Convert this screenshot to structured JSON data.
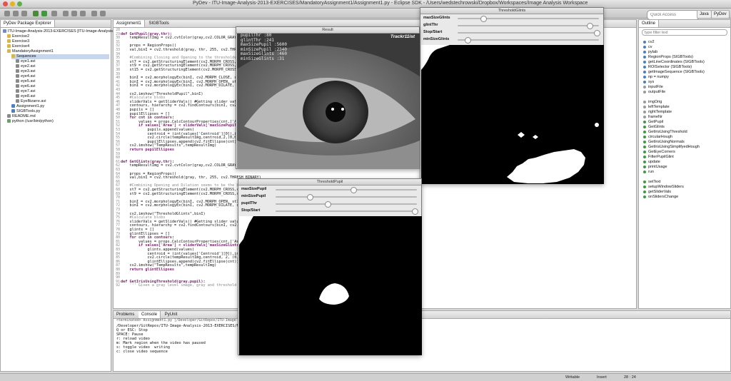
{
  "window": {
    "title": "PyDev - ITU-Image-Analysis-2013-EXERCISES/MandatoryAssignment1/Assignment1.py - Eclipse SDK - /Users/wedstechrowski/Dropbox/Workspaces/Image Analysis Workspace"
  },
  "toolbar": {
    "quick_access_placeholder": "Quick Access",
    "perspectives": [
      "Java",
      "PyDev"
    ]
  },
  "explorer": {
    "tab_label": "PyDev Package Explorer",
    "items": [
      {
        "label": "ITU-Image-Analysis-2013-EXERCISES [ITU-Image-Analysis-2013]",
        "depth": 0,
        "type": "project"
      },
      {
        "label": "Exercise2",
        "depth": 1,
        "type": "folder"
      },
      {
        "label": "Exercise3",
        "depth": 1,
        "type": "folder"
      },
      {
        "label": "Exercise4",
        "depth": 1,
        "type": "folder"
      },
      {
        "label": "MandatoryAssignment1",
        "depth": 1,
        "type": "folder"
      },
      {
        "label": "Sequences",
        "depth": 2,
        "type": "folder",
        "selected": true
      },
      {
        "label": "eye1.avi",
        "depth": 3,
        "type": "file"
      },
      {
        "label": "eye2.avi",
        "depth": 3,
        "type": "file"
      },
      {
        "label": "eye3.avi",
        "depth": 3,
        "type": "file"
      },
      {
        "label": "eye4.avi",
        "depth": 3,
        "type": "file"
      },
      {
        "label": "eye5.avi",
        "depth": 3,
        "type": "file"
      },
      {
        "label": "eye6.avi",
        "depth": 3,
        "type": "file"
      },
      {
        "label": "eye7.avi",
        "depth": 3,
        "type": "file"
      },
      {
        "label": "eye8.avi",
        "depth": 3,
        "type": "file"
      },
      {
        "label": "EyeBizarre.avi",
        "depth": 3,
        "type": "file"
      },
      {
        "label": "Assignment1.py",
        "depth": 2,
        "type": "py"
      },
      {
        "label": "SIGBTools.py",
        "depth": 2,
        "type": "py"
      },
      {
        "label": "README.md",
        "depth": 1,
        "type": "file"
      },
      {
        "label": "python (/usr/bin/python)",
        "depth": 1,
        "type": "lib"
      }
    ]
  },
  "editor": {
    "tabs": [
      "Assignment1",
      "SIGBTools"
    ],
    "lines": [
      {
        "n": "28",
        "t": ""
      },
      {
        "n": "29",
        "t": "def GetPupil(gray,thr):",
        "k": true
      },
      {
        "n": "30",
        "t": "    tempResultImg = cv2.cvtColor(gray,cv2.COLOR_GRAY2BGR)"
      },
      {
        "n": "31",
        "t": ""
      },
      {
        "n": "32",
        "t": "    props = RegionProps()"
      },
      {
        "n": "33",
        "t": "    val,binI = cv2.threshold(gray, thr, 255, cv2.THRESH_BINARY_INV)"
      },
      {
        "n": "34",
        "t": ""
      },
      {
        "n": "35",
        "t": "    #Combining Closing and Opening to the thresholded image",
        "c": true
      },
      {
        "n": "36",
        "t": "    st7 = cv2.getStructuringElement(cv2.MORPH_CROSS,(7,7))"
      },
      {
        "n": "37",
        "t": "    st9 = cv2.getStructuringElement(cv2.MORPH_CROSS,(9,9))"
      },
      {
        "n": "38",
        "t": "    st15 = cv2.getStructuringElement(cv2.MORPH_CROSS,(15,15))"
      },
      {
        "n": "39",
        "t": ""
      },
      {
        "n": "40",
        "t": "    binI = cv2.morphologyEx(binI, cv2.MORPH_CLOSE, st9)"
      },
      {
        "n": "41",
        "t": "    binI = cv2.morphologyEx(binI, cv2.MORPH_OPEN, st15)"
      },
      {
        "n": "42",
        "t": "    binI = cv2.morphologyEx(binI, cv2.MORPH_DILATE, st7)"
      },
      {
        "n": "43",
        "t": ""
      },
      {
        "n": "44",
        "t": "    cv2.imshow(\"ThresholdPupil\",binI)"
      },
      {
        "n": "45",
        "t": "    #Calculate blobs",
        "c": true
      },
      {
        "n": "46",
        "t": "    sliderVals = getSliderVals() #Getting slider values",
        "c2": true
      },
      {
        "n": "47",
        "t": "    contours, hierarchy = cv2.findContours(binI, cv2.RETR_LIST, cv2.CHAIN_APPROX_SIMPLE)"
      },
      {
        "n": "48",
        "t": "    pupils = []"
      },
      {
        "n": "49",
        "t": "    pupilEllipses = []"
      },
      {
        "n": "50",
        "t": "    for cnt in contours:",
        "k": true
      },
      {
        "n": "51",
        "t": "        values = props.CalcContourProperties(cnt,['Area','Length','Centroid'])"
      },
      {
        "n": "52",
        "t": "        if values['Area'] < sliderVals['maxSizePupil']:",
        "k": true
      },
      {
        "n": "53",
        "t": "            pupils.append(values)"
      },
      {
        "n": "54",
        "t": "            centroid = (int(values['Centroid'][0]),int(values['Centroid'][1]))"
      },
      {
        "n": "55",
        "t": "            cv2.circle(tempResultImg,centroid,2,(0,0,255),4)"
      },
      {
        "n": "56",
        "t": "            pupilEllipses.append(cv2.fitEllipse(cnt))"
      },
      {
        "n": "57",
        "t": "    cv2.imshow(\"TempResults\",tempResultImg)"
      },
      {
        "n": "58",
        "t": "    return pupilEllipses",
        "k": true
      },
      {
        "n": "59",
        "t": ""
      },
      {
        "n": "60",
        "t": ""
      },
      {
        "n": "61",
        "t": "def GetGlints(gray,thr):",
        "k": true
      },
      {
        "n": "62",
        "t": "    tempResultImg = cv2.cvtColor(gray,cv2.COLOR_GRAY2BGR)"
      },
      {
        "n": "63",
        "t": ""
      },
      {
        "n": "64",
        "t": "    props = RegionProps()"
      },
      {
        "n": "65",
        "t": "    val,binI = cv2.threshold(gray, thr, 255, cv2.THRESH_BINARY)"
      },
      {
        "n": "66",
        "t": ""
      },
      {
        "n": "67",
        "t": "    #Combining Opening and Dilation seems to be the best",
        "c": true
      },
      {
        "n": "68",
        "t": "    st7 = cv2.getStructuringElement(cv2.MORPH_CROSS,(7,7))"
      },
      {
        "n": "69",
        "t": "    st9 = cv2.getStructuringElement(cv2.MORPH_CROSS,(9,9))"
      },
      {
        "n": "70",
        "t": ""
      },
      {
        "n": "71",
        "t": "    binI = cv2.morphologyEx(binI, cv2.MORPH_OPEN, st7)"
      },
      {
        "n": "72",
        "t": "    binI = cv2.morphologyEx(binI, cv2.MORPH_DILATE, st9)"
      },
      {
        "n": "73",
        "t": ""
      },
      {
        "n": "74",
        "t": "    cv2.imshow(\"ThresholdGlints\",binI)"
      },
      {
        "n": "75",
        "t": "    #Calculate blobs",
        "c": true
      },
      {
        "n": "76",
        "t": "    sliderVals = getSliderVals() #Getting slider values",
        "c2": true
      },
      {
        "n": "77",
        "t": "    contours, hierarchy = cv2.findContours(binI, cv2.RETR_LIST, cv2.CHAIN_APPROX_SIMPLE)"
      },
      {
        "n": "78",
        "t": "    glints = []"
      },
      {
        "n": "79",
        "t": "    glintEllipses = []"
      },
      {
        "n": "80",
        "t": "    for cnt in contours:",
        "k": true
      },
      {
        "n": "81",
        "t": "        values = props.CalcContourProperties(cnt,['Area','Length','Centroid'])"
      },
      {
        "n": "82",
        "t": "        if values['Area'] < sliderVals['maxSizeGlints']:",
        "k": true
      },
      {
        "n": "83",
        "t": "            glints.append(values)"
      },
      {
        "n": "84",
        "t": "            centroid = (int(values['Centroid'][0]),int(values['Centroid'][1]))"
      },
      {
        "n": "85",
        "t": "            cv2.circle(tempResultImg,centroid, 2, (0,0,255),4)"
      },
      {
        "n": "86",
        "t": "            glintEllipses.append(cv2.fitEllipse(cnt))"
      },
      {
        "n": "87",
        "t": "    cv2.imshow(\"TempResults\",tempResultImg)"
      },
      {
        "n": "88",
        "t": "    return glintEllipses",
        "k": true
      },
      {
        "n": "89",
        "t": ""
      },
      {
        "n": "90",
        "t": ""
      },
      {
        "n": "91",
        "t": "def GetIrisUsingThreshold(gray,pupil):",
        "k": true
      },
      {
        "n": "92",
        "t": "    ''' Given a gray level image, gray and threshold",
        "c": true
      }
    ]
  },
  "result_window": {
    "title": "Result",
    "overlay_lines": [
      "pupilThr :80",
      "glintThr :241",
      "maxSizePupil :5600",
      "minSizePupil :2340",
      "maxSizeGlints :460",
      "minSizeGlints :31"
    ],
    "brand": "Trackr11ist"
  },
  "threshold_glints": {
    "title": "ThresholdGlints",
    "sliders": [
      {
        "label": "maxSizeGlints",
        "value": 0.17
      },
      {
        "label": "glintThr",
        "value": 0.95
      },
      {
        "label": "Stop/Start",
        "value": 1.0
      },
      {
        "label": "minSizeGlints",
        "value": 0.05
      }
    ]
  },
  "threshold_pupil": {
    "title": "ThresholdPupil",
    "sliders": [
      {
        "label": "maxSizePupil",
        "value": 0.55
      },
      {
        "label": "minSizePupil",
        "value": 0.23
      },
      {
        "label": "pupilThr",
        "value": 0.36
      },
      {
        "label": "Stop/Start",
        "value": 1.0
      }
    ]
  },
  "outline": {
    "tab_label": "Outline",
    "filter_placeholder": "type filter text",
    "items": [
      {
        "label": "cv2",
        "kind": "import"
      },
      {
        "label": "cv",
        "kind": "import"
      },
      {
        "label": "pylab",
        "kind": "import"
      },
      {
        "label": "RegionProps (SIGBTools)",
        "kind": "import"
      },
      {
        "label": "getLineCoordinates (SIGBTools)",
        "kind": "import"
      },
      {
        "label": "ROISelector (SIGBTools)",
        "kind": "import"
      },
      {
        "label": "getImageSequence (SIGBTools)",
        "kind": "import"
      },
      {
        "label": "np = numpy",
        "kind": "import"
      },
      {
        "label": "sys",
        "kind": "import"
      },
      {
        "label": "inputFile",
        "kind": "var"
      },
      {
        "label": "outputFile",
        "kind": "var"
      },
      {
        "label": "",
        "kind": "gap"
      },
      {
        "label": "imgOrig",
        "kind": "var"
      },
      {
        "label": "leftTemplate",
        "kind": "var"
      },
      {
        "label": "rightTemplate",
        "kind": "var"
      },
      {
        "label": "frameNr",
        "kind": "var"
      },
      {
        "label": "GetPupil",
        "kind": "func"
      },
      {
        "label": "GetGlints",
        "kind": "func"
      },
      {
        "label": "GetIrisUsingThreshold",
        "kind": "func"
      },
      {
        "label": "circularHough",
        "kind": "func"
      },
      {
        "label": "GetIrisUsingNormals",
        "kind": "func"
      },
      {
        "label": "GetIrisUsingSimplifyedHough",
        "kind": "func"
      },
      {
        "label": "GetEyeCorners",
        "kind": "func"
      },
      {
        "label": "FilterPupilGlint",
        "kind": "func"
      },
      {
        "label": "update",
        "kind": "func"
      },
      {
        "label": "printUsage",
        "kind": "func"
      },
      {
        "label": "run",
        "kind": "func"
      },
      {
        "label": "",
        "kind": "gap"
      },
      {
        "label": "setText",
        "kind": "func"
      },
      {
        "label": "setupWindowSliders",
        "kind": "func"
      },
      {
        "label": "getSliderVals",
        "kind": "func"
      },
      {
        "label": "onSlidersChange",
        "kind": "func"
      }
    ]
  },
  "console": {
    "tabs": [
      "Problems",
      "Console",
      "PyUnit"
    ],
    "header": "<terminated> Assignment1.py [/Developer/GitRepos/ITU-Image-Analysis-2013-EXERCISES/MandatoryAssignment1/Assignment1.py]",
    "lines": [
      "/Developer/GitRepos/ITU-Image-Analysis-2013-EXERCISES/MandatoryAssignment1/",
      "Q or ESC: Stop",
      "SPACE: Pause",
      "r: reload video",
      "m: Mark region when the video has paused",
      "s: toggle video  writing",
      "c: close video sequence"
    ]
  },
  "status": {
    "writable": "Writable",
    "insert": "Insert",
    "position": "28 : 24"
  }
}
